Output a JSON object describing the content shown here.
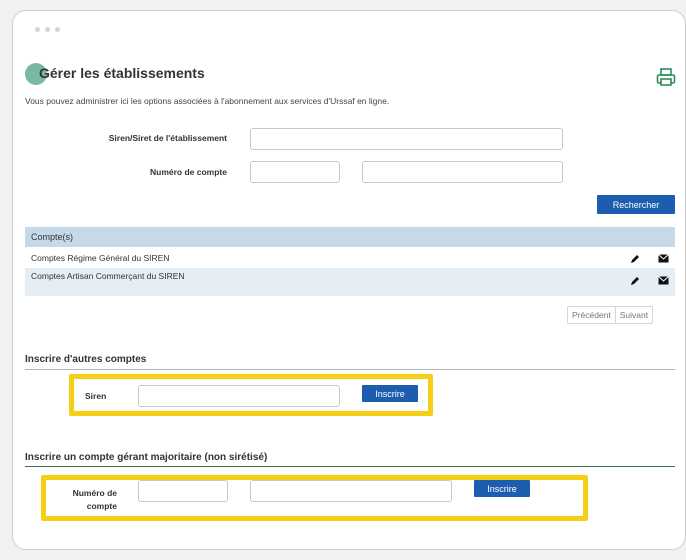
{
  "page": {
    "title": "Gérer les établissements",
    "subtitle": "Vous pouvez administrer ici les options associées à l'abonnement aux services d'Urssaf en ligne."
  },
  "search_form": {
    "siren_label": "Siren/Siret de l'établissement",
    "account_label": "Numéro de compte",
    "search_button": "Rechercher"
  },
  "accounts": {
    "header": "Compte(s)",
    "rows": [
      {
        "label": "Comptes Régime Général du SIREN"
      },
      {
        "label": "Comptes Artisan Commerçant du SIREN"
      }
    ]
  },
  "pagination": {
    "previous": "Précédent",
    "next": "Suivant"
  },
  "other_accounts": {
    "title": "Inscrire d'autres comptes",
    "siren_label": "Siren",
    "button": "Inscrire"
  },
  "manager_account": {
    "title": "Inscrire un compte gérant majoritaire (non sirétisé)",
    "account_label_line1": "Numéro de",
    "account_label_line2": "compte",
    "button": "Inscrire"
  },
  "colors": {
    "primary_button": "#1c5db0",
    "table_header": "#c6d9e8",
    "highlight": "#f5cf15",
    "title_circle": "#79b8a3",
    "print_icon": "#2d8a5a"
  },
  "icons": {
    "print": "print-icon",
    "edit": "pencil-icon",
    "mail": "envelope-icon"
  }
}
